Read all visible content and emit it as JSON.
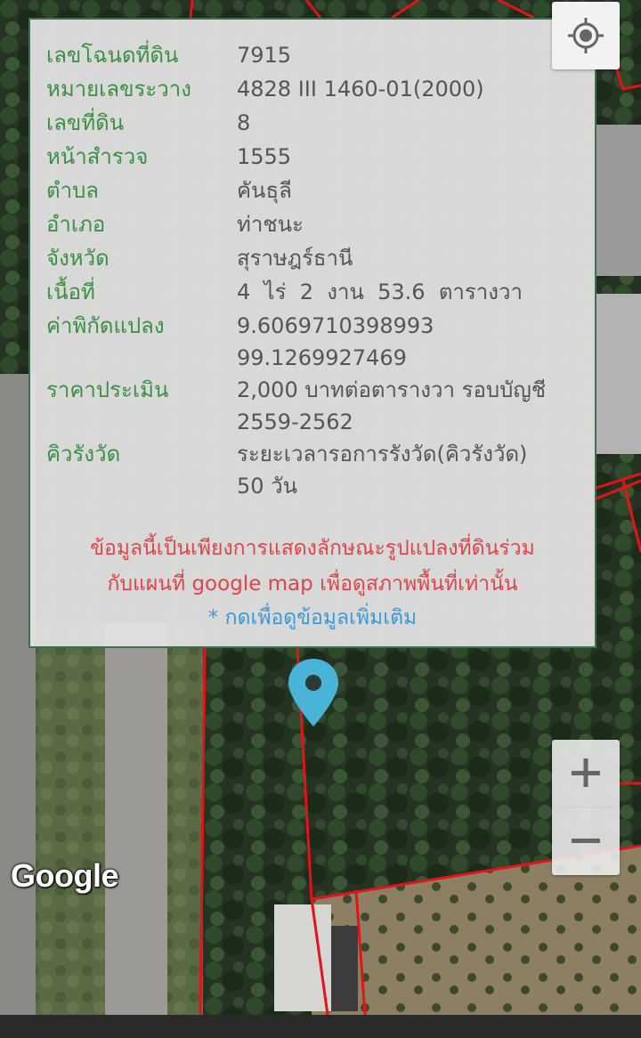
{
  "info": {
    "rows": [
      {
        "label": "เลขโฉนดที่ดิน",
        "value": "7915"
      },
      {
        "label": "หมายเลขระวาง",
        "value": "4828 III 1460-01(2000)"
      },
      {
        "label": "เลขที่ดิน",
        "value": "8"
      },
      {
        "label": "หน้าสำรวจ",
        "value": "1555"
      },
      {
        "label": "ตำบล",
        "value": "คันธุลี"
      },
      {
        "label": "อำเภอ",
        "value": "ท่าชนะ"
      },
      {
        "label": "จังหวัด",
        "value": "สุราษฎร์ธานี"
      },
      {
        "label": "เนื้อที่",
        "value": "4  ไร่  2  งาน  53.6  ตารางวา"
      },
      {
        "label": "ค่าพิกัดแปลง",
        "value": "9.6069710398993",
        "value2": "99.1269927469"
      },
      {
        "label": "ราคาประเมิน",
        "value": "2,000 บาทต่อตารางวา รอบบัญชี",
        "value2": "2559-2562"
      },
      {
        "label": "คิวรังวัด",
        "value": "ระยะเวลารอการรังวัด(คิวรังวัด)",
        "value2": "50 วัน"
      }
    ],
    "disclaimer_line1": "ข้อมูลนี้เป็นเพียงการแสดงลักษณะรูปแปลงที่ดินร่วม",
    "disclaimer_line2": "กับแผนที่ google map เพื่อดูสภาพพื้นที่เท่านั้น",
    "more_link": "* กดเพื่อดูข้อมูลเพิ่มเติม"
  },
  "map": {
    "attribution": "Google",
    "locate_icon": "my-location-icon",
    "zoom_in_icon": "plus-icon",
    "zoom_out_icon": "minus-icon",
    "pin_icon": "map-pin-icon",
    "parcel_line_color": "#e3121b",
    "pin_color": "#4ab3d8"
  },
  "colors": {
    "label": "#3d8f45",
    "value": "#555555",
    "disclaimer": "#e0444a",
    "link": "#3a9ad9",
    "panel_border": "#3f6f50"
  }
}
